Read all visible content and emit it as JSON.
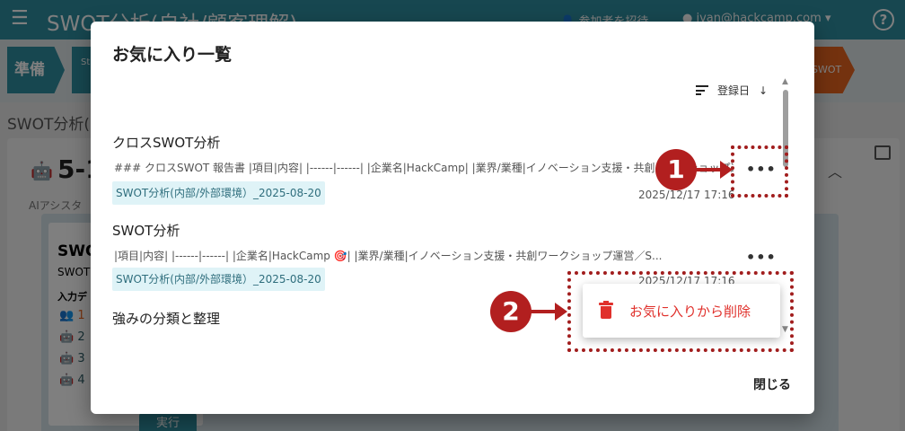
{
  "app": {
    "title": "SWOT分析(自社/顧客理解)",
    "invite_label": "参加者を招待",
    "user_email": "ivan@hackcamp.com",
    "help_label": "?"
  },
  "background": {
    "step_prep": "準備",
    "step_next": "St",
    "step_right": "SWOT",
    "heading": "SWOT分析(",
    "section_num": "5-1",
    "ai_label": "AIアシスタ",
    "card_title": "SWOT",
    "card_sub": "SWOT",
    "card_input": "入力デ",
    "rows": [
      "1",
      "2",
      "3",
      "4"
    ],
    "run_label": "実行"
  },
  "modal": {
    "title": "お気に入り一覧",
    "sort_label": "登録日",
    "sort_arrow": "↓",
    "close_label": "閉じる",
    "items": [
      {
        "title": "クロスSWOT分析",
        "excerpt": "### クロスSWOT 報告書 |項目|内容| |------|------| |企業名|HackCamp| |業界/業種|イノベーション支援・共創ワークショップ運営／S...",
        "tag": "SWOT分析(内部/外部環境）_2025-08-20",
        "date": "2025/12/17 17:16"
      },
      {
        "title": "SWOT分析",
        "excerpt": "|項目|内容| |------|------| |企業名|HackCamp 🎯| |業界/業種|イノベーション支援・共創ワークショップ運営／S...",
        "tag": "SWOT分析(内部/外部環境）_2025-08-20",
        "date": "2025/12/17 17:16"
      },
      {
        "title": "強みの分類と整理"
      }
    ],
    "context_menu": {
      "remove_label": "お気に入りから削除"
    }
  },
  "annotations": {
    "marker_1": "1",
    "marker_2": "2",
    "color": "#b21f1f"
  }
}
